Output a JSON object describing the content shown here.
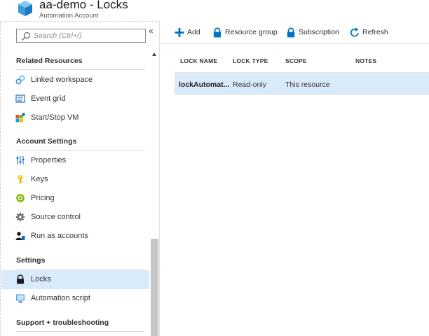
{
  "header": {
    "title": "aa-demo - Locks",
    "subtitle": "Automation Account",
    "icon": "automation-account-cube-icon"
  },
  "sidebar": {
    "search_placeholder": "Search (Ctrl+/)",
    "collapse_glyph": "«",
    "sections": [
      {
        "title": "Related Resources",
        "items": [
          {
            "label": "Linked workspace",
            "icon": "linked-workspace-icon"
          },
          {
            "label": "Event grid",
            "icon": "event-grid-icon"
          },
          {
            "label": "Start/Stop VM",
            "icon": "start-stop-vm-icon"
          }
        ]
      },
      {
        "title": "Account Settings",
        "items": [
          {
            "label": "Properties",
            "icon": "properties-icon"
          },
          {
            "label": "Keys",
            "icon": "key-icon"
          },
          {
            "label": "Pricing",
            "icon": "pricing-icon"
          },
          {
            "label": "Source control",
            "icon": "gear-icon"
          },
          {
            "label": "Run as accounts",
            "icon": "run-as-accounts-icon"
          }
        ]
      },
      {
        "title": "Settings",
        "items": [
          {
            "label": "Locks",
            "icon": "lock-icon",
            "selected": true
          },
          {
            "label": "Automation script",
            "icon": "automation-script-icon"
          }
        ]
      },
      {
        "title": "Support + troubleshooting",
        "items": []
      }
    ]
  },
  "toolbar": {
    "add_label": "Add",
    "resource_group_label": "Resource group",
    "subscription_label": "Subscription",
    "refresh_label": "Refresh"
  },
  "table": {
    "columns": [
      "LOCK NAME",
      "LOCK TYPE",
      "SCOPE",
      "NOTES"
    ],
    "rows": [
      {
        "name": "lockAutomat...",
        "type": "Read-only",
        "scope": "This resource",
        "notes": ""
      }
    ]
  },
  "colors": {
    "accent": "#0072c6",
    "selected_bg": "#d9ebfb",
    "text": "#323130"
  }
}
